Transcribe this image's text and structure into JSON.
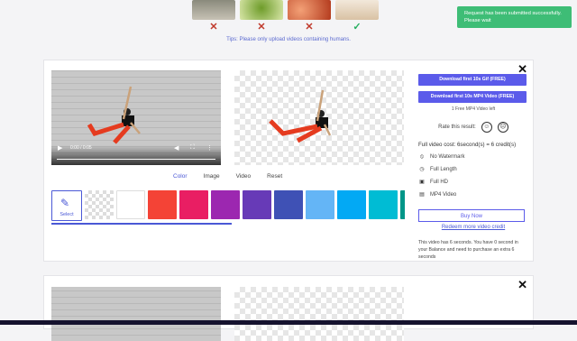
{
  "thumbs": [
    {
      "color1": "#8a8a7c",
      "color2": "#c7c2b5",
      "mark": "✕",
      "status": "x"
    },
    {
      "color1": "#6e9c2a",
      "color2": "#d8e6a8",
      "mark": "✕",
      "status": "x"
    },
    {
      "color1": "#b43b1e",
      "color2": "#f3a076",
      "mark": "✕",
      "status": "x"
    },
    {
      "color1": "#d9c2a4",
      "color2": "#f2e8da",
      "mark": "✓",
      "status": "ok"
    }
  ],
  "tips": "Tips: Please only upload videos containing humans.",
  "toast": "Request has been submitted successfully. Please wait",
  "card": {
    "close_icon": "✕",
    "video_time": "0:00 / 0:05",
    "tabs": [
      "Color",
      "Image",
      "Video",
      "Reset"
    ],
    "select_label": "Select",
    "swatches": [
      "transparent",
      "#ffffff",
      "#f44336",
      "#e91e63",
      "#9c27b0",
      "#673ab7",
      "#3f51b5",
      "#64b5f6",
      "#03a9f4",
      "#00bcd4",
      "#009688"
    ],
    "btn_gif": "Download first 10s Gif (FREE)",
    "btn_mp4": "Download first 10s MP4 Video (FREE)",
    "free_left": "1 Free MP4 Video left",
    "rate_label": "Rate this result:",
    "cost": "Full video cost: 6second(s) = 6 credit(s)",
    "features": [
      "No Watermark",
      "Full Length",
      "Full HD",
      "MP4 Video"
    ],
    "buy": "Buy Now",
    "redeem": "Redeem more video credit",
    "info": "This video has 6 seconds. You have 0 second in your Balance and need to purchase an extra 6 seconds"
  }
}
